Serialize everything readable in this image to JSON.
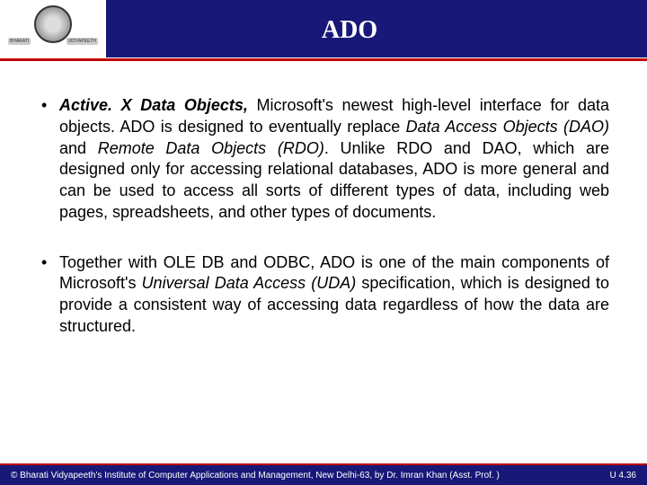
{
  "header": {
    "title": "ADO",
    "logo_left_text": "BHARATI",
    "logo_right_text": "VIDYAPEETH"
  },
  "content": {
    "bullets": [
      {
        "lead_bold_italic": "Active. X Data Objects,",
        "text_1": " Microsoft's newest high-level interface for data objects. ADO is designed to eventually replace ",
        "italic_1": "Data Access Objects (DAO)",
        "text_2": " and ",
        "italic_2": "Remote Data Objects (RDO)",
        "text_3": ". Unlike RDO and DAO, which are designed only for accessing relational databases, ADO is more general and can be used to access all sorts of different types of data, including web pages, spreadsheets, and other types of documents."
      },
      {
        "text_1": "Together with OLE DB and ODBC, ADO is one of the main components of Microsoft's ",
        "italic_1": "Universal Data Access (UDA)",
        "text_2": " specification, which is designed to provide a consistent way of accessing data regardless of how the data are structured."
      }
    ]
  },
  "footer": {
    "copyright": "© Bharati Vidyapeeth's Institute of Computer Applications and Management, New Delhi-63, by  Dr. Imran Khan (Asst. Prof. )",
    "page_ref": "U 4.36"
  }
}
